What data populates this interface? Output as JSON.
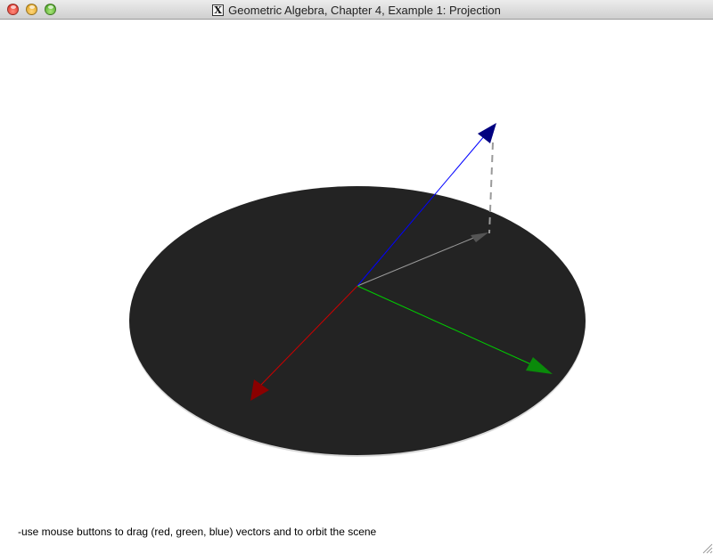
{
  "window": {
    "title": "Geometric Algebra, Chapter 4, Example 1: Projection",
    "x_icon_letter": "X"
  },
  "scene": {
    "plane_color": "#232323",
    "vectors": [
      {
        "name": "red",
        "color": "#cc0000",
        "head_color": "#8a0000"
      },
      {
        "name": "green",
        "color": "#00cc00",
        "head_color": "#0a8a0a"
      },
      {
        "name": "blue",
        "color": "#0000ff",
        "head_color": "#000080"
      },
      {
        "name": "projection",
        "color": "#9a9a9a",
        "head_color": "#555555"
      }
    ]
  },
  "status": {
    "instructions": "-use mouse buttons to drag (red, green, blue) vectors and to orbit the scene"
  }
}
